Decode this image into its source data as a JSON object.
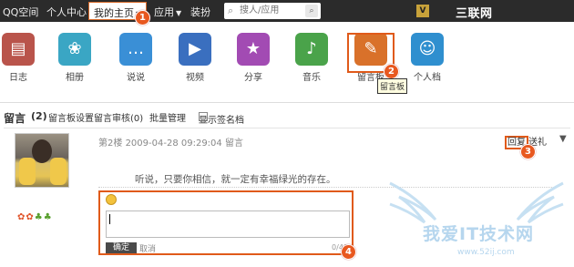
{
  "topbar": {
    "brand": "QQ空间",
    "personal_center": "个人中心",
    "my_home": "我的主页",
    "apps": "应用",
    "dress_up": "装扮",
    "search_placeholder": "搜人/应用",
    "watermark": "三联网 3LIAN.COM"
  },
  "apps": [
    {
      "label": "日志",
      "icon": "diary-icon",
      "color": "#b9544b"
    },
    {
      "label": "相册",
      "icon": "album-icon",
      "color": "#3aa6c4"
    },
    {
      "label": "说说",
      "icon": "talk-icon",
      "color": "#3a8fd6"
    },
    {
      "label": "视频",
      "icon": "video-icon",
      "color": "#3a6fbf"
    },
    {
      "label": "分享",
      "icon": "share-icon",
      "color": "#a24bb3"
    },
    {
      "label": "音乐",
      "icon": "music-icon",
      "color": "#4aa34a"
    },
    {
      "label": "留言板",
      "icon": "message-board-icon",
      "color": "#d9712a"
    },
    {
      "label": "个人档",
      "icon": "profile-icon",
      "color": "#2f8fcf"
    }
  ],
  "tooltip": "留言板",
  "message_bar": {
    "title": "留言",
    "count": "(2)",
    "settings": "留言板设置",
    "review": "留言审核(0)",
    "batch": "批量管理",
    "show_signature": "显示签名档"
  },
  "message": {
    "floor": "第2楼",
    "datetime": "2009-04-28 09:29:04",
    "type": "留言",
    "reply": "回复",
    "gift": "送礼",
    "content": "听说，只要你相信，就一定有幸福绿光的存在。"
  },
  "reply_box": {
    "ok": "确定",
    "cancel": "取消",
    "counter": "0/40"
  },
  "badges": [
    "1",
    "2",
    "3",
    "4"
  ],
  "watermark_bottom": {
    "text": "我爱IT技术网",
    "url": "www.52ij.com"
  }
}
